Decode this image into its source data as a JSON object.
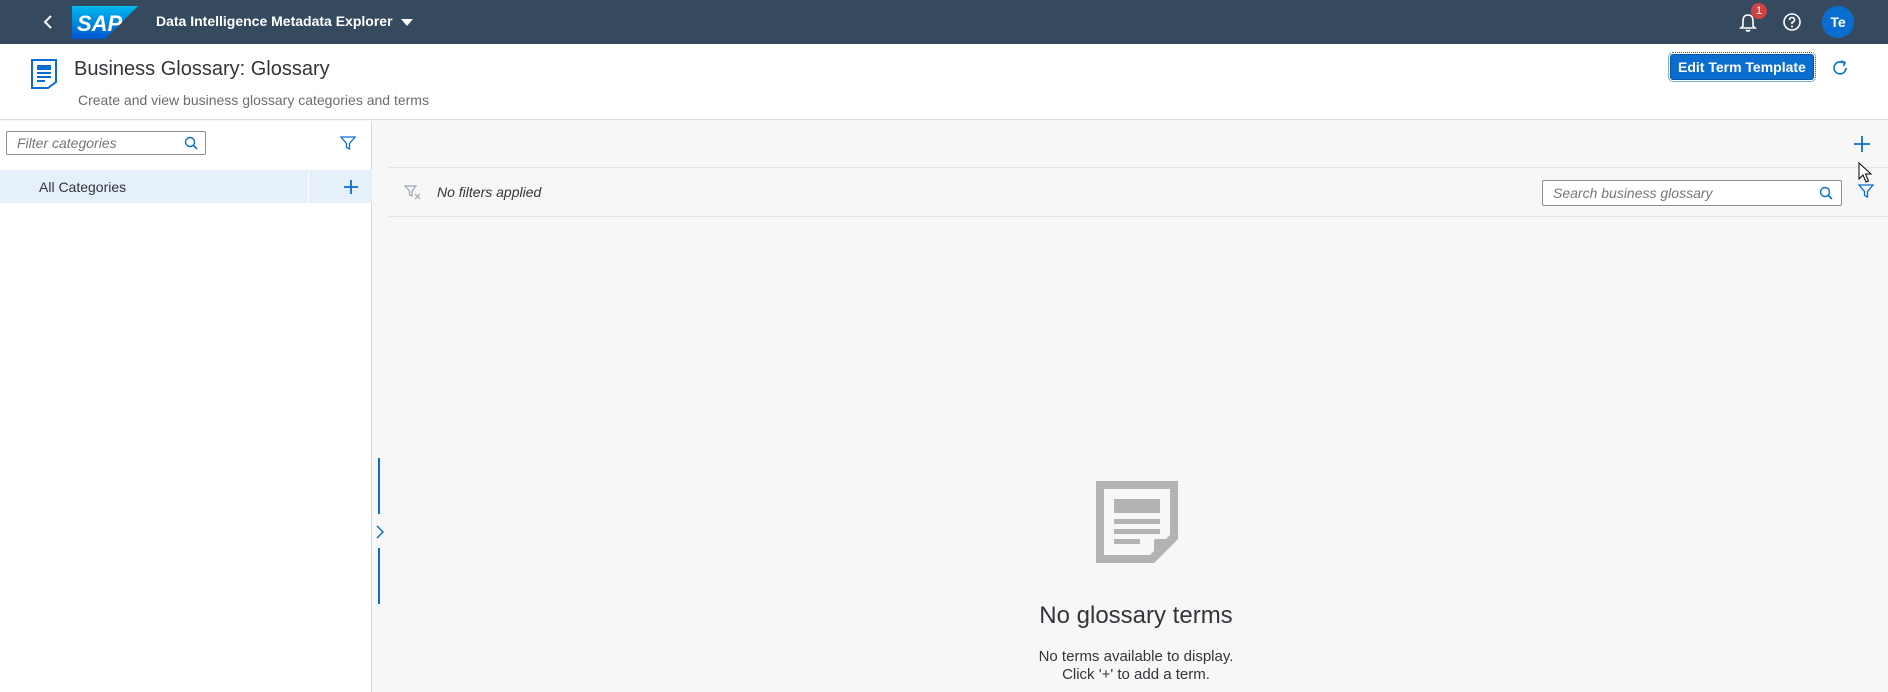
{
  "shell": {
    "logo_text": "SAP",
    "app_title": "Data Intelligence Metadata Explorer",
    "notification_count": "1",
    "avatar_initials": "Te"
  },
  "header": {
    "title": "Business Glossary: Glossary",
    "subtitle": "Create and view business glossary categories and terms",
    "edit_template_label": "Edit Term Template"
  },
  "categories": {
    "filter_placeholder": "Filter categories",
    "all_label": "All Categories"
  },
  "terms": {
    "filter_status": "No filters applied",
    "search_placeholder": "Search business glossary",
    "empty_title": "No glossary terms",
    "empty_line1": "No terms available to display.",
    "empty_line2": "Click '+' to add a term."
  },
  "colors": {
    "shell": "#354a5f",
    "accent": "#0a6ed1",
    "selection": "#e5f0fa",
    "badge": "#d04343"
  }
}
